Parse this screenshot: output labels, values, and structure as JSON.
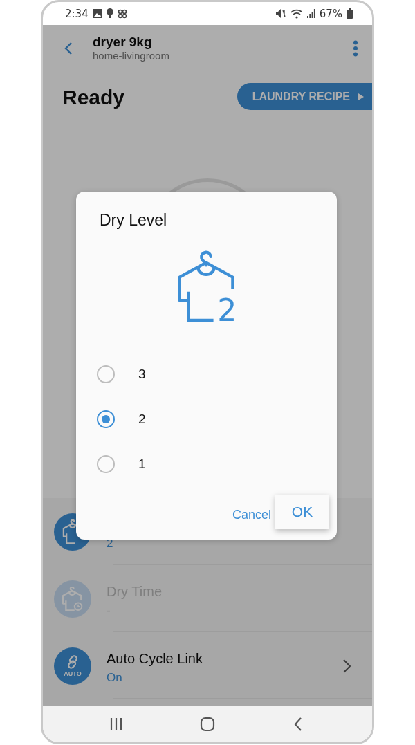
{
  "status_bar": {
    "time": "2:34",
    "battery": "67%"
  },
  "header": {
    "title": "dryer 9kg",
    "subtitle": "home-livingroom"
  },
  "state": "Ready",
  "recipe_button": "LAUNDRY RECIPE",
  "settings": [
    {
      "kind": "dry_level",
      "value": "2",
      "disabled": false
    },
    {
      "kind": "dry_time",
      "title": "Dry Time",
      "value": "-",
      "disabled": true
    },
    {
      "kind": "auto_cycle",
      "title": "Auto Cycle Link",
      "value": "On",
      "icon_label": "AUTO",
      "disabled": false
    }
  ],
  "dialog": {
    "title": "Dry Level",
    "icon_label": "2",
    "options": [
      {
        "label": "3",
        "selected": false
      },
      {
        "label": "2",
        "selected": true
      },
      {
        "label": "1",
        "selected": false
      }
    ],
    "buttons": [
      {
        "label": "Cancel",
        "kind": "text"
      },
      {
        "label": "OK",
        "kind": "raised"
      }
    ]
  }
}
